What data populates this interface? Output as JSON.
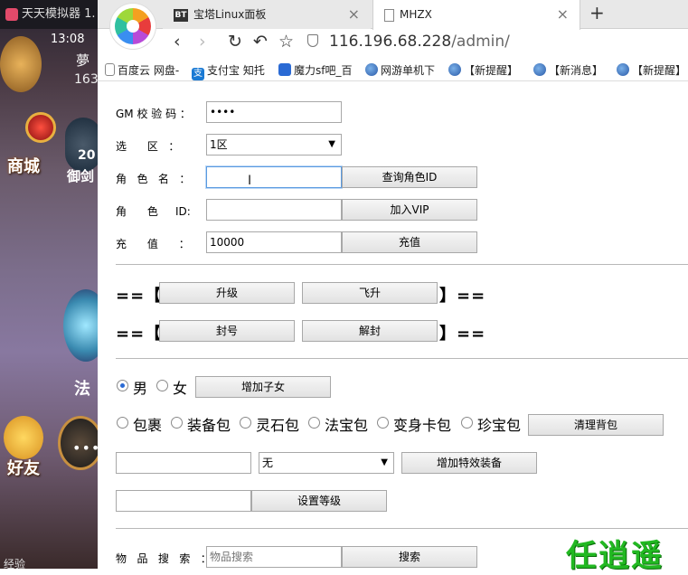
{
  "emulator": {
    "title": "天天模拟器 1.",
    "clock": "13:08",
    "char_top": "夢",
    "num_top": "163",
    "shop": "商城",
    "count": "20",
    "sword": "御剑",
    "fa": "法",
    "friend": "好友",
    "dots": "•••",
    "bottom": "经验"
  },
  "browser": {
    "tabs": [
      {
        "icon": "BT",
        "label": "宝塔Linux面板",
        "close": "×"
      },
      {
        "label": "MHZX",
        "close": "×"
      }
    ],
    "new_tab": "+",
    "address_host": "116.196.68.228",
    "address_path": "/admin/",
    "nav": {
      "back": "‹",
      "forward": "›",
      "reload": "↻",
      "undo": "↶",
      "star": "☆"
    },
    "bookmarks": [
      {
        "label": "百度云 网盘-"
      },
      {
        "label": "支付宝 知托",
        "icon_text": "支"
      },
      {
        "label": "魔力sf吧_百"
      },
      {
        "label": "网游单机下"
      },
      {
        "label": "【新提醒】"
      },
      {
        "label": "【新消息】"
      },
      {
        "label": "【新提醒】"
      }
    ]
  },
  "form": {
    "gm_label": "GM 校 验 码 ：",
    "gm_value": "••••",
    "zone_label": "选      区   ：",
    "zone_value": "1区",
    "zone_arrow": "▼",
    "role_name_label": "角   色   名   ：",
    "role_name_value": "",
    "query_role_btn": "查询角色ID",
    "role_id_label": "角      色     ID:",
    "role_id_value": "",
    "vip_btn": "加入VIP",
    "recharge_label": "充      值      ：",
    "recharge_value": "10000",
    "recharge_btn": "充值",
    "bracket_left": "==【",
    "bracket_right": "】==",
    "levelup_btn": "升级",
    "ascend_btn": "飞升",
    "ban_btn": "封号",
    "unban_btn": "解封",
    "gender": {
      "male": "男",
      "female": "女",
      "selected": "male"
    },
    "add_child_btn": "增加子女",
    "bags": [
      "包裹",
      "装备包",
      "灵石包",
      "法宝包",
      "变身卡包",
      "珍宝包"
    ],
    "clear_bag_btn": "清理背包",
    "equip_input_value": "",
    "effect_value": "无",
    "add_effect_btn": "增加特效装备",
    "level_input_value": "",
    "set_level_btn": "设置等级",
    "item_search_label": "物   品   搜   索   ：",
    "item_search_placeholder": "物品搜索",
    "search_btn": "搜索"
  },
  "watermark": "任逍遥"
}
